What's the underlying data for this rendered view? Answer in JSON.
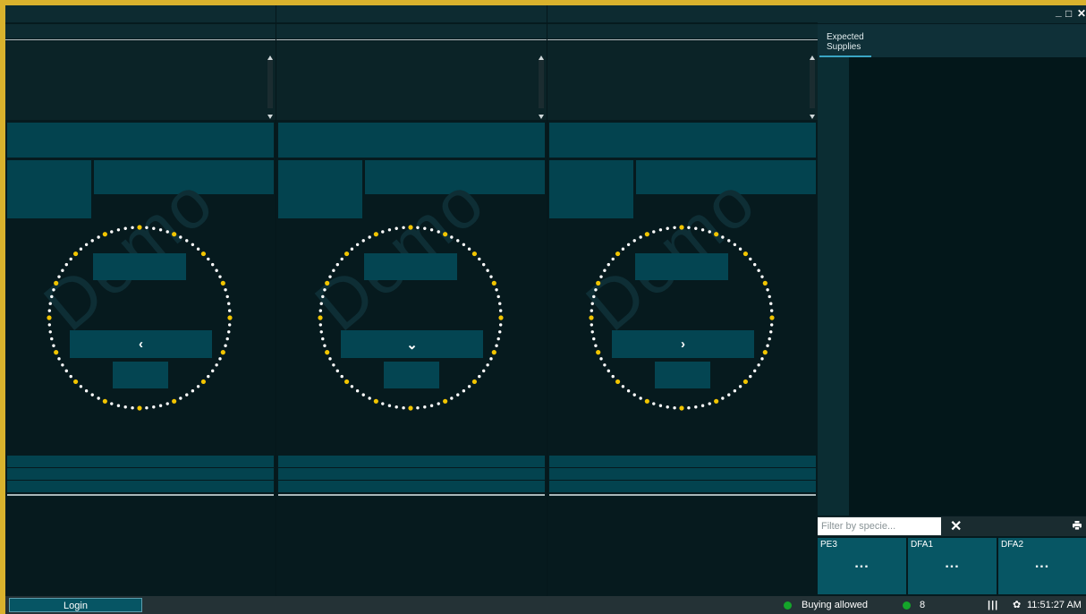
{
  "window_controls": {
    "minimize": "_",
    "maximize": "□",
    "close": "✕"
  },
  "side_panel": {
    "tab_label_line1": "Expected",
    "tab_label_line2": "Supplies",
    "filter_placeholder": "Filter by specie...",
    "clear_icon": "✕",
    "tiles": [
      {
        "name": "PE3",
        "more": "..."
      },
      {
        "name": "DFA1",
        "more": "..."
      },
      {
        "name": "DFA2",
        "more": "..."
      }
    ]
  },
  "panels": [
    {
      "watermark": "Demo",
      "nav_glyph": "‹",
      "nav_icon": "chevron-left-icon"
    },
    {
      "watermark": "Demo",
      "nav_glyph": "⌄",
      "nav_icon": "chevron-down-icon"
    },
    {
      "watermark": "Demo",
      "nav_glyph": "›",
      "nav_icon": "chevron-right-icon"
    }
  ],
  "statusbar": {
    "login_label": "Login",
    "buying_status": "Buying allowed",
    "count": "8",
    "bars_glyph": "|||",
    "gear_glyph": "✿",
    "time": "11:51:27 AM"
  },
  "colors": {
    "border": "#d9b22d",
    "dot_white": "#ffffff",
    "dot_yellow": "#f2c500",
    "status_green": "#14a52a",
    "accent": "#3aa5c4"
  }
}
